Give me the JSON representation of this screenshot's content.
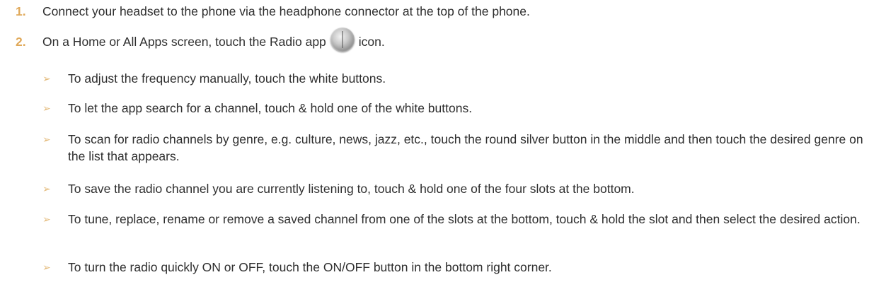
{
  "steps": [
    {
      "number": "1.",
      "text": "Connect your headset to the phone via the headphone connector at the top of the phone."
    },
    {
      "number": "2.",
      "text_before": "On a Home or All Apps screen, touch the Radio app",
      "icon": "radio-app-icon",
      "text_after": "icon."
    }
  ],
  "bullet_glyph": "➢",
  "bullets": [
    "To adjust the frequency manually, touch the white buttons.",
    "To let the app search for a channel, touch & hold one of the white buttons.",
    "To scan for radio channels by genre, e.g. culture, news, jazz, etc., touch the round silver button in the middle and then touch the desired genre on the list that appears.",
    "To save the radio channel you are currently listening to, touch & hold one of the four slots at the bottom.",
    "To tune, replace, rename or remove a saved channel from one of the slots at the bottom, touch & hold the slot and then select the desired action.",
    "To turn the radio quickly ON or OFF, touch the ON/OFF button in the bottom right corner."
  ],
  "colors": {
    "number": "#e0a95a",
    "arrow": "#e3b978",
    "text": "#2e2e2e"
  }
}
